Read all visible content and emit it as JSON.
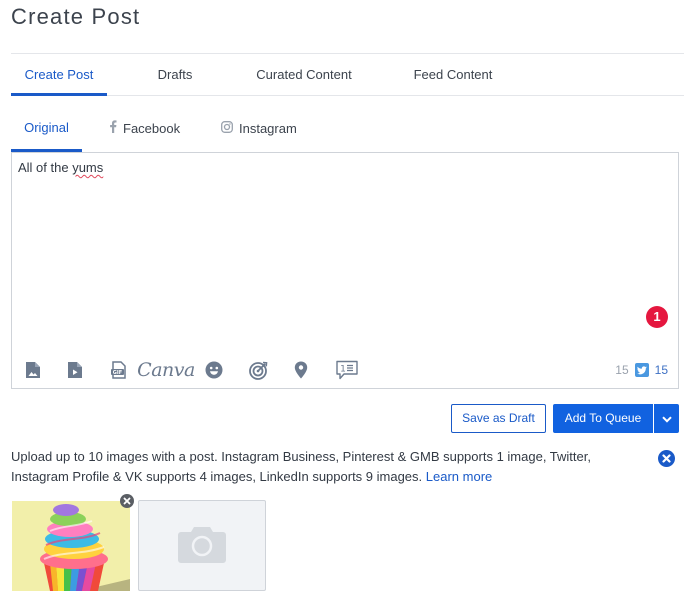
{
  "page": {
    "title": "Create Post"
  },
  "main_tabs": [
    {
      "label": "Create Post",
      "active": true
    },
    {
      "label": "Drafts",
      "active": false
    },
    {
      "label": "Curated Content",
      "active": false
    },
    {
      "label": "Feed Content",
      "active": false
    }
  ],
  "sub_tabs": [
    {
      "label": "Original",
      "icon": "",
      "active": true
    },
    {
      "label": "Facebook",
      "icon": "facebook-icon",
      "active": false
    },
    {
      "label": "Instagram",
      "icon": "instagram-icon",
      "active": false
    }
  ],
  "editor": {
    "text_before": "All of the ",
    "text_misspelled": "yums",
    "notification_count": "1",
    "toolbar": [
      {
        "icon": "image-file-icon"
      },
      {
        "icon": "video-file-icon"
      },
      {
        "icon": "gif-file-icon"
      },
      {
        "icon": "canva-icon",
        "label": "Canva"
      },
      {
        "icon": "emoji-icon"
      },
      {
        "icon": "target-icon"
      },
      {
        "icon": "location-pin-icon"
      },
      {
        "icon": "first-comment-icon"
      }
    ],
    "char_count": "15",
    "twitter_char_count": "15"
  },
  "actions": {
    "save_draft_label": "Save as Draft",
    "add_queue_label": "Add To Queue"
  },
  "info": {
    "text": "Upload up to 10 images with a post. Instagram Business, Pinterest & GMB supports 1 image, Twitter, Instagram Profile & VK supports 4 images, LinkedIn supports 9 images.",
    "link_label": "Learn more"
  },
  "media": {
    "thumbnails": [
      {
        "alt": "rainbow cupcake"
      }
    ],
    "upload_icon": "camera-icon"
  },
  "colors": {
    "accent": "#1a5ac8",
    "primary_button": "#1162e0",
    "badge": "#e5173f",
    "twitter": "#4a98e0"
  }
}
